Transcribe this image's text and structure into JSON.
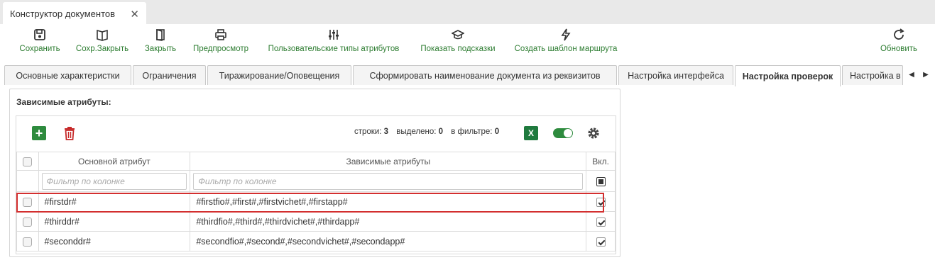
{
  "window": {
    "tab_title": "Конструктор документов"
  },
  "toolbar": {
    "save_label": "Сохранить",
    "save_close_label": "Сохр.Закрыть",
    "close_label": "Закрыть",
    "preview_label": "Предпросмотр",
    "attr_types_label": "Пользовательские типы атрибутов",
    "hints_label": "Показать подсказки",
    "route_template_label": "Создать шаблон маршрута",
    "refresh_label": "Обновить"
  },
  "tabs": [
    {
      "label": "Основные характеристки"
    },
    {
      "label": "Ограничения"
    },
    {
      "label": "Тиражирование/Оповещения"
    },
    {
      "label": "Сформировать наименование документа из реквизитов"
    },
    {
      "label": "Настройка интерфейса"
    },
    {
      "label": "Настройка проверок"
    },
    {
      "label": "Настройка в"
    }
  ],
  "panel": {
    "title": "Зависимые атрибуты:"
  },
  "grid": {
    "stats_rows_label": "строки:",
    "stats_rows_value": "3",
    "stats_selected_label": "выделено:",
    "stats_selected_value": "0",
    "stats_filter_label": "в фильтре:",
    "stats_filter_value": "0",
    "excel_label": "X",
    "columns": [
      "Основной атрибут",
      "Зависимые атрибуты",
      "Вкл."
    ],
    "filter_placeholder": "Фильтр по колонке",
    "rows": [
      {
        "main": "#firstdr#",
        "dependent": "#firstfio#,#first#,#firstvichet#,#firstapp#",
        "enabled": true
      },
      {
        "main": "#thirddr#",
        "dependent": "#thirdfio#,#third#,#thirdvichet#,#thirdapp#",
        "enabled": true
      },
      {
        "main": "#seconddr#",
        "dependent": "#secondfio#,#second#,#secondvichet#,#secondapp#",
        "enabled": true
      }
    ]
  },
  "colors": {
    "accent_green": "#2e7d32",
    "highlight_red": "#d32f2f",
    "delete_red": "#c62828"
  }
}
